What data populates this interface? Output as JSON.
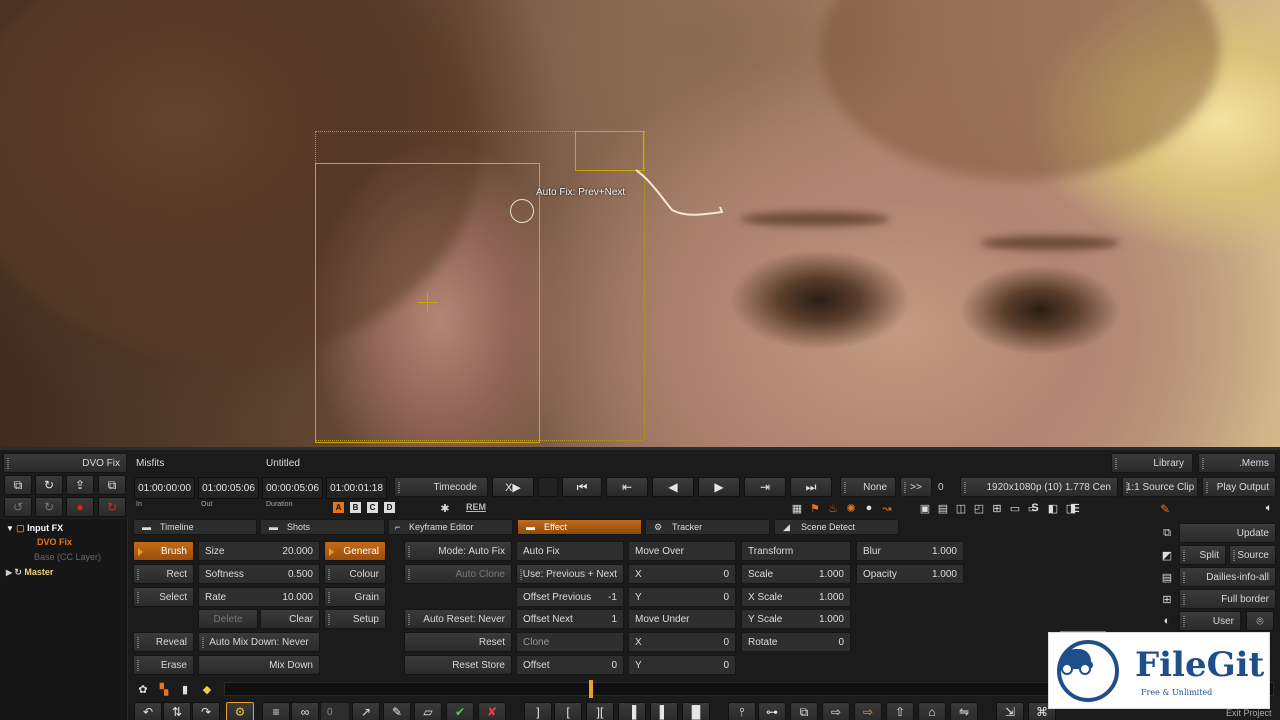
{
  "viewer": {
    "overlay_label": "Auto Fix: Prev+Next"
  },
  "header": {
    "module_selector": "DVO Fix",
    "project_name": "Misfits",
    "clip_name": "Untitled",
    "library": "Library",
    "mems": ".Mems",
    "timecode_label": "Timecode",
    "none_label": "None",
    "chevrons": ">>",
    "zero": "0",
    "resolution": "1920x1080p (10) 1.778 Cen",
    "source_clip": "1:1 Source Clip",
    "play_output": "Play Output",
    "rem": "REM",
    "letters": [
      "A",
      "B",
      "C",
      "D"
    ]
  },
  "timecodes": {
    "in": "01:00:00:00",
    "out": "01:00:05:06",
    "duration": "00:00:05:06",
    "current": "01:00:01:18",
    "in_label": "In",
    "out_label": "Out",
    "duration_label": "Duration"
  },
  "tree": {
    "input_fx": "Input FX",
    "dvo_fix": "DVO Fix",
    "base": "Base (CC Layer)",
    "master": "Master"
  },
  "tabs": [
    "Timeline",
    "Shots",
    "Keyframe Editor",
    "Effect",
    "Tracker",
    "Scene Detect"
  ],
  "tools": {
    "brush": "Brush",
    "rect": "Rect",
    "select": "Select",
    "reveal": "Reveal",
    "erase": "Erase",
    "size_label": "Size",
    "size_value": "20.000",
    "softness_label": "Softness",
    "softness_value": "0.500",
    "rate_label": "Rate",
    "rate_value": "10.000",
    "delete": "Delete",
    "clear": "Clear",
    "auto_mix_down": "Auto Mix Down: Never",
    "mix_down": "Mix Down",
    "general": "General",
    "colour": "Colour",
    "grain": "Grain",
    "setup": "Setup"
  },
  "autofix": {
    "mode": "Mode: Auto Fix",
    "auto_clone": "Auto Clone",
    "auto_reset": "Auto Reset: Never",
    "reset": "Reset",
    "reset_store": "Reset Store",
    "header": "Auto Fix",
    "use_label": "Use: Previous + Next",
    "offset_previous_label": "Offset Previous",
    "offset_previous_value": "-1",
    "offset_next_label": "Offset Next",
    "offset_next_value": "1",
    "clone_label": "Clone",
    "offset_label": "Offset",
    "offset_value": "0"
  },
  "move": {
    "move_over": "Move Over",
    "x_label": "X",
    "x_value": "0",
    "y_label": "Y",
    "y_value": "0",
    "move_under": "Move Under",
    "x2_label": "X",
    "x2_value": "0",
    "y2_label": "Y",
    "y2_value": "0"
  },
  "transform": {
    "header": "Transform",
    "scale_label": "Scale",
    "scale_value": "1.000",
    "xscale_label": "X Scale",
    "xscale_value": "1.000",
    "yscale_label": "Y Scale",
    "yscale_value": "1.000",
    "rotate_label": "Rotate",
    "rotate_value": "0"
  },
  "blur": {
    "blur_label": "Blur",
    "blur_value": "1.000",
    "opacity_label": "Opacity",
    "opacity_value": "1.000"
  },
  "right_panel": {
    "update": "Update",
    "split": "Split",
    "source": "Source",
    "dailies": "Dailies-info-all",
    "full_border": "Full border",
    "user": "User",
    "exit_project": "Exit Project"
  },
  "bottom": {
    "frame_value": "0"
  },
  "logo": {
    "name": "FileGit",
    "tagline": "Free & Unlimited"
  },
  "colors": {
    "accent_orange": "#c26a18",
    "overlay_yellow": "#c9a800",
    "logo_blue": "#1f4f8a"
  }
}
